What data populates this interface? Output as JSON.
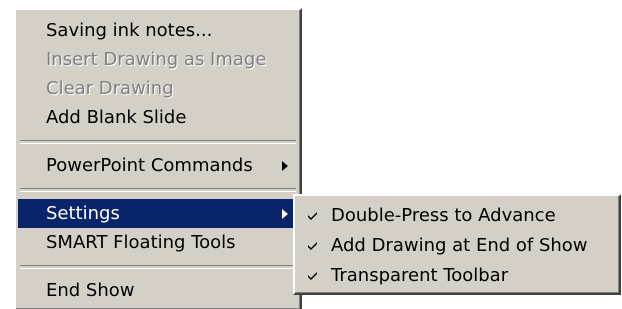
{
  "main_menu": {
    "items": [
      {
        "label": "Saving ink notes...",
        "enabled": true
      },
      {
        "label": "Insert Drawing as Image",
        "enabled": false
      },
      {
        "label": "Clear Drawing",
        "enabled": false
      },
      {
        "label": "Add Blank Slide",
        "enabled": true
      },
      {
        "label": "PowerPoint Commands",
        "enabled": true,
        "submenu": true
      },
      {
        "label": "Settings",
        "enabled": true,
        "submenu": true,
        "highlighted": true
      },
      {
        "label": "SMART Floating Tools",
        "enabled": true
      },
      {
        "label": "End Show",
        "enabled": true
      }
    ]
  },
  "settings_submenu": {
    "items": [
      {
        "label": "Double-Press to Advance",
        "checked": true
      },
      {
        "label": "Add Drawing at End of Show",
        "checked": true
      },
      {
        "label": "Transparent Toolbar",
        "checked": true
      }
    ]
  },
  "colors": {
    "menu_background": "#d4d0c8",
    "highlight_background": "#0a246a",
    "highlight_text": "#ffffff",
    "disabled_text": "#808080"
  },
  "icons": {
    "submenu_arrow": "chevron-right-icon",
    "checkmark": "checkmark-icon"
  }
}
